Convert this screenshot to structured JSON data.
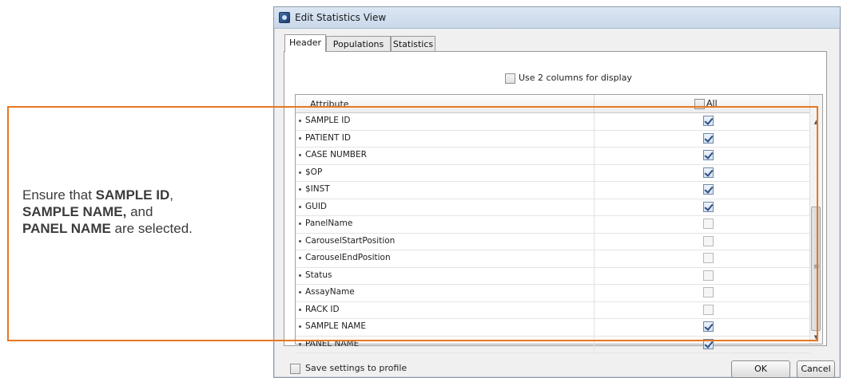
{
  "callout": {
    "pre1": "Ensure that ",
    "bold1": "SAMPLE ID",
    "sep1": ",",
    "bold2": "SAMPLE NAME,",
    "mid": " and",
    "bold3": "PANEL NAME",
    "post": " are selected."
  },
  "dialog": {
    "title": "Edit Statistics View",
    "tabs": {
      "header": "Header",
      "populations": "Populations",
      "statistics": "Statistics"
    },
    "use_two_columns_label": "Use 2 columns for display",
    "table": {
      "col_attribute": "Attribute",
      "col_all": "All",
      "rows": [
        {
          "name": "SAMPLE ID",
          "checked": true
        },
        {
          "name": "PATIENT ID",
          "checked": true
        },
        {
          "name": "CASE NUMBER",
          "checked": true
        },
        {
          "name": "$OP",
          "checked": true
        },
        {
          "name": "$INST",
          "checked": true
        },
        {
          "name": "GUID",
          "checked": true
        },
        {
          "name": "PanelName",
          "checked": false
        },
        {
          "name": "CarouselStartPosition",
          "checked": false
        },
        {
          "name": "CarouselEndPosition",
          "checked": false
        },
        {
          "name": "Status",
          "checked": false
        },
        {
          "name": "AssayName",
          "checked": false
        },
        {
          "name": "RACK ID",
          "checked": false
        },
        {
          "name": "SAMPLE NAME",
          "checked": true
        },
        {
          "name": "PANEL NAME",
          "checked": true
        }
      ]
    },
    "save_settings_label": "Save settings to profile",
    "ok_label": "OK",
    "cancel_label": "Cancel"
  },
  "colors": {
    "highlight": "#e87722",
    "check": "#2d4f86"
  },
  "icons": {
    "scroll_up": "triangle-up-icon",
    "scroll_down": "triangle-down-icon",
    "scroll_grip": "grip-icon"
  }
}
